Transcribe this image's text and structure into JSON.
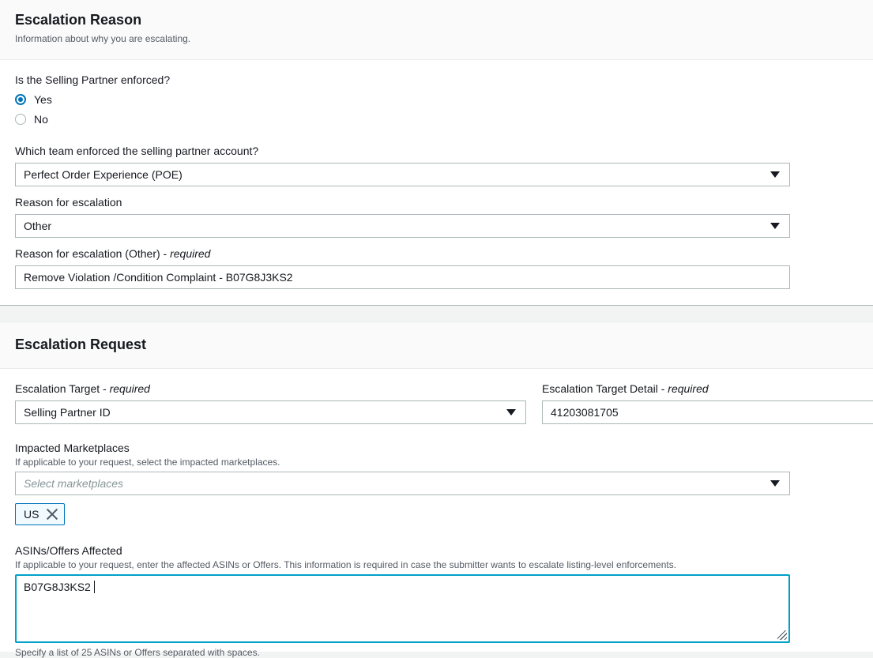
{
  "reason_section": {
    "title": "Escalation Reason",
    "description": "Information about why you are escalating.",
    "enforced_question": "Is the Selling Partner enforced?",
    "radio_options": [
      {
        "label": "Yes",
        "checked": true
      },
      {
        "label": "No",
        "checked": false
      }
    ],
    "team_label": "Which team enforced the selling partner account?",
    "team_value": "Perfect Order Experience (POE)",
    "reason_label": "Reason for escalation",
    "reason_value": "Other",
    "reason_other_label": "Reason for escalation (Other)",
    "reason_other_required": "required",
    "reason_other_value": "Remove Violation /Condition Complaint - B07G8J3KS2"
  },
  "request_section": {
    "title": "Escalation Request",
    "target_label": "Escalation Target",
    "target_required": "required",
    "target_value": "Selling Partner ID",
    "target_detail_label": "Escalation Target Detail",
    "target_detail_required": "required",
    "target_detail_value": "41203081705",
    "marketplaces_label": "Impacted Marketplaces",
    "marketplaces_hint": "If applicable to your request, select the impacted marketplaces.",
    "marketplaces_placeholder": "Select marketplaces",
    "marketplace_tokens": [
      "US"
    ],
    "asins_label": "ASINs/Offers Affected",
    "asins_hint": "If applicable to your request, enter the affected ASINs or Offers. This information is required in case the submitter wants to escalate listing-level enforcements.",
    "asins_value": "B07G8J3KS2",
    "asins_footer_hint": "Specify a list of 25 ASINs or Offers separated with spaces."
  },
  "colors": {
    "accent": "#0073bb",
    "focus": "#00a1c9",
    "border": "#aab7b8",
    "text": "#16191f",
    "muted": "#545b64",
    "background": "#f2f3f3"
  },
  "icons": [
    "caret-down-icon",
    "close-icon",
    "resize-handle-icon"
  ]
}
